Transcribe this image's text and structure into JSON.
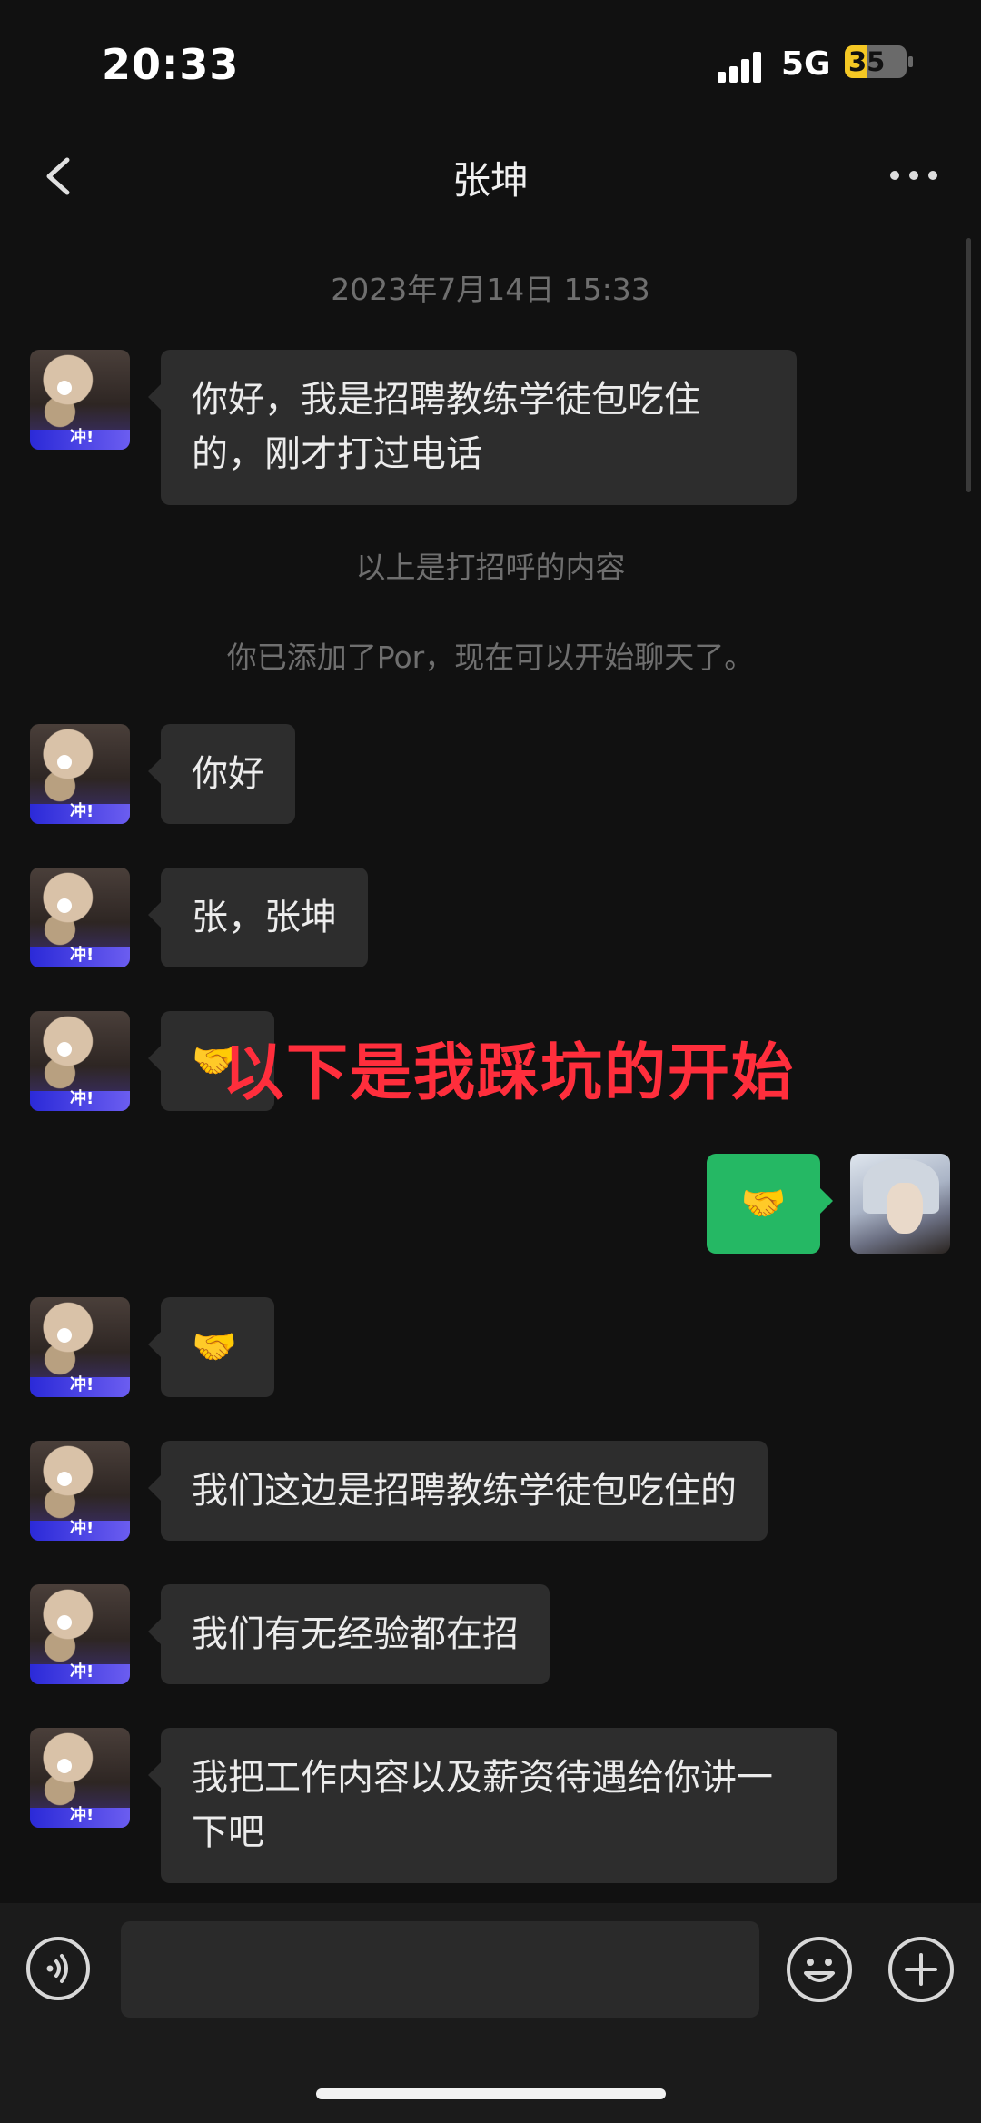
{
  "status_bar": {
    "time": "20:33",
    "network": "5G",
    "battery": "35",
    "battery_level": 0.35
  },
  "nav": {
    "title": "张坤"
  },
  "conversation": {
    "timestamp": "2023年7月14日 15:33",
    "notice_greeting": "以上是打招呼的内容",
    "notice_added": "你已添加了Por，现在可以开始聊天了。",
    "contact_avatar_caption": "冲!",
    "messages": [
      {
        "from": "them",
        "text": "你好，我是招聘教练学徒包吃住的，刚才打过电话"
      },
      {
        "from": "them",
        "text": "你好"
      },
      {
        "from": "them",
        "text": "张，张坤"
      },
      {
        "from": "them",
        "text": "🤝"
      },
      {
        "from": "me",
        "text": "🤝"
      },
      {
        "from": "them",
        "text": "🤝"
      },
      {
        "from": "them",
        "text": "我们这边是招聘教练学徒包吃住的"
      },
      {
        "from": "them",
        "text": "我们有无经验都在招"
      },
      {
        "from": "them",
        "text": "我把工作内容以及薪资待遇给你讲一下吧"
      }
    ]
  },
  "overlay_annotation": {
    "text": "以下是我踩坑的开始",
    "color": "#ff2e3c"
  },
  "icons": [
    "back-chevron-icon",
    "more-dots-icon",
    "voice-icon",
    "emoji-icon",
    "plus-icon"
  ],
  "colors": {
    "background": "#111111",
    "bubble_in": "#2d2d2d",
    "bubble_out": "#25b864"
  }
}
